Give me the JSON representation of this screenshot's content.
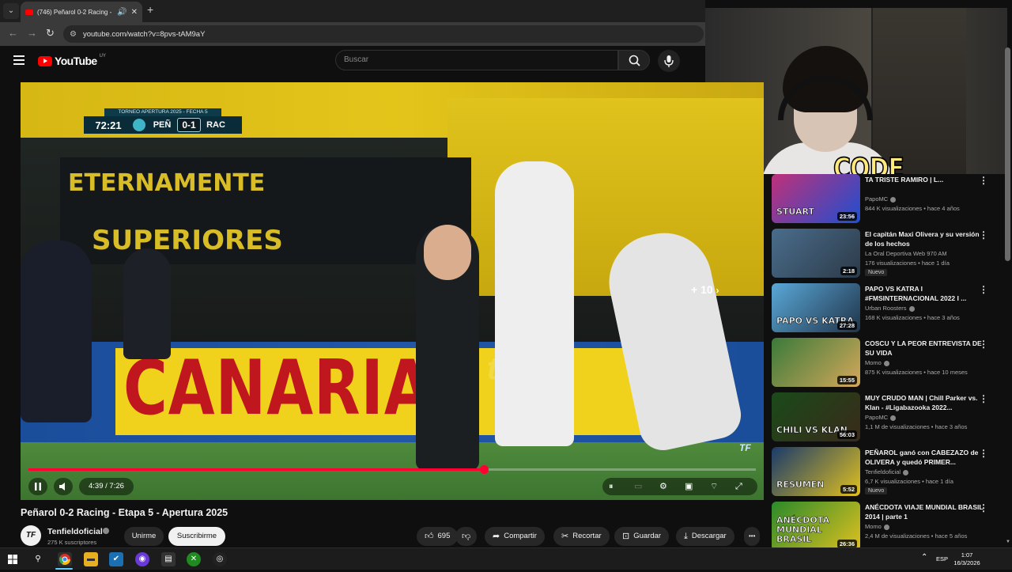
{
  "browser": {
    "tab_title": "(746) Peñarol 0-2 Racing - E",
    "tab_dropdown_icon": "chevron-down-icon",
    "new_tab": "+",
    "url": "youtube.com/watch?v=8pvs-tAM9aY"
  },
  "youtube": {
    "logo_text": "YouTube",
    "region": "UY",
    "search_placeholder": "Buscar"
  },
  "webcam": {
    "overlay_text": "CODE"
  },
  "video": {
    "scoreboard": {
      "competition": "TORNEO APERTURA 2025 - FECHA 5",
      "clock": "72:21",
      "home": "PEÑ",
      "score": "0-1",
      "away": "RAC"
    },
    "banner_left": "ETERNAMENTE",
    "banner_left2": "SUPERIORES",
    "adboard": "CANARIAS",
    "watermark": "tenfi",
    "seek_hint": "+ 10",
    "logo": "TF",
    "time": "4:39 / 7:26",
    "progress": 0.626,
    "title": "Peñarol 0-2 Racing - Etapa 5 - Apertura 2025"
  },
  "channel": {
    "avatar_text": "TF",
    "name": "Tenfieldoficial",
    "subscribers": "275 K suscriptores",
    "join": "Unirme",
    "subscribe": "Suscribirme"
  },
  "actions": {
    "likes": "695",
    "share": "Compartir",
    "clip": "Recortar",
    "save": "Guardar",
    "download": "Descargar",
    "more": "•••"
  },
  "recommendations": [
    {
      "title": "TA TRISTE RAMIRO | L...",
      "channel": "PapoMC",
      "verified": true,
      "meta": "844 K visualizaciones • hace 4 años",
      "duration": "23:56",
      "badge": "",
      "thumb_text": "STUART",
      "c1": "#c0307a",
      "c2": "#1e4fd0"
    },
    {
      "title": "El capitán Maxi Olivera y su versión de los hechos",
      "channel": "La Oral Deportiva Web 970 AM",
      "verified": false,
      "meta": "176 visualizaciones • hace 1 día",
      "duration": "2:18",
      "badge": "Nuevo",
      "thumb_text": "",
      "c1": "#4a6d8c",
      "c2": "#2c3a48"
    },
    {
      "title": "PAPO VS KATRA I #FMSINTERNACIONAL 2022 I ...",
      "channel": "Urban Roosters",
      "verified": true,
      "meta": "168 K visualizaciones • hace 3 años",
      "duration": "27:28",
      "badge": "",
      "thumb_text": "PAPO VS KATRA",
      "c1": "#5aa8d8",
      "c2": "#20344a"
    },
    {
      "title": "COSCU Y LA PEOR ENTREVISTA DE SU VIDA",
      "channel": "Momo",
      "verified": true,
      "meta": "875 K visualizaciones • hace 10 meses",
      "duration": "15:55",
      "badge": "",
      "thumb_text": "",
      "c1": "#3a7a3a",
      "c2": "#d4a85a"
    },
    {
      "title": "MUY CRUDO MAN | Chill Parker vs. Klan - #Ligabazooka 2022...",
      "channel": "PapoMC",
      "verified": true,
      "meta": "1,1 M de visualizaciones • hace 3 años",
      "duration": "56:03",
      "badge": "",
      "thumb_text": "CHILI VS KLAN",
      "c1": "#1a4a1a",
      "c2": "#3a2a1a"
    },
    {
      "title": "PEÑAROL ganó con CABEZAZO de OLIVERA y quedó PRIMER...",
      "channel": "Tenfieldoficial",
      "verified": true,
      "meta": "6,7 K visualizaciones • hace 1 día",
      "duration": "5:52",
      "badge": "Nuevo",
      "thumb_text": "RESUMEN",
      "c1": "#1a3a6a",
      "c2": "#e0c020"
    },
    {
      "title": "ANÉCDOTA VIAJE MUNDIAL BRASIL 2014 | parte 1",
      "channel": "Momo",
      "verified": true,
      "meta": "2,4 M de visualizaciones • hace 5 años",
      "duration": "26:36",
      "badge": "",
      "thumb_text": "ANÉCDOTA MUNDIAL BRASIL",
      "c1": "#2a8a2a",
      "c2": "#e0c020"
    }
  ],
  "taskbar": {
    "language": "ESP",
    "time": "1:07",
    "date": "16/3/2026"
  },
  "colors": {
    "youtube_red": "#ff0000",
    "progress_red": "#ff0033",
    "background": "#0f0f0f"
  }
}
